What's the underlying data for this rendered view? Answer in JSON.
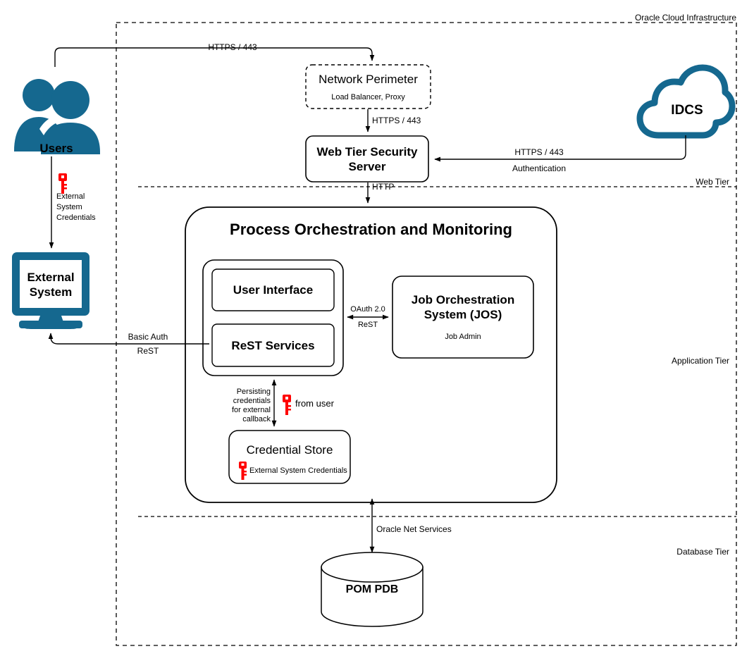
{
  "diagram": {
    "cloud_boundary_label": "Oracle Cloud Infrastructure",
    "tiers": [
      {
        "name": "web",
        "label": "Web Tier"
      },
      {
        "name": "application",
        "label": "Application Tier"
      },
      {
        "name": "database",
        "label": "Database Tier"
      }
    ],
    "nodes": {
      "users": {
        "label": "Users",
        "icon": "users-icon"
      },
      "external_system": {
        "line1": "External",
        "line2": "System",
        "icon": "monitor-icon"
      },
      "idcs": {
        "label": "IDCS",
        "icon": "cloud-icon"
      },
      "network_perimeter": {
        "title": "Network Perimeter",
        "subtitle": "Load Balancer, Proxy"
      },
      "web_tier_security_server": {
        "line1": "Web Tier Security",
        "line2": "Server"
      },
      "pom": {
        "title": "Process Orchestration and Monitoring"
      },
      "user_interface": {
        "title": "User Interface"
      },
      "rest_services": {
        "title": "ReST Services"
      },
      "jos": {
        "line1": "Job Orchestration",
        "line2": "System (JOS)",
        "subtitle": "Job Admin"
      },
      "credential_store": {
        "title": "Credential Store",
        "badge": "External System Credentials",
        "badge_icon": "key-icon"
      },
      "pom_pdb": {
        "label": "POM PDB",
        "icon": "database-cylinder"
      }
    },
    "edges": {
      "users_to_perimeter": "HTTPS / 443",
      "perimeter_to_websec": "HTTPS / 443",
      "idcs_to_websec_line1": "HTTPS / 443",
      "idcs_to_websec_line2": "Authentication",
      "websec_to_pom": "HTTP",
      "users_to_external_l1": "External",
      "users_to_external_l2": "System",
      "users_to_external_l3": "Credentials",
      "users_to_external_icon": "key-icon",
      "external_to_rest_l1": "Basic Auth",
      "external_to_rest_l2": "ReST",
      "ui_to_jos_l1": "OAuth 2.0",
      "ui_to_jos_l2": "ReST",
      "rest_to_credstore_l1": "Persisting",
      "rest_to_credstore_l2": "credentials",
      "rest_to_credstore_l3": "for external",
      "rest_to_credstore_l4": "callback",
      "from_user_label": "from user",
      "from_user_icon": "key-icon",
      "pom_to_pdb": "Oracle Net Services"
    },
    "colors": {
      "accent_blue": "#15688f",
      "key_red": "#ff0000",
      "stroke": "#000000",
      "background": "#ffffff"
    }
  }
}
